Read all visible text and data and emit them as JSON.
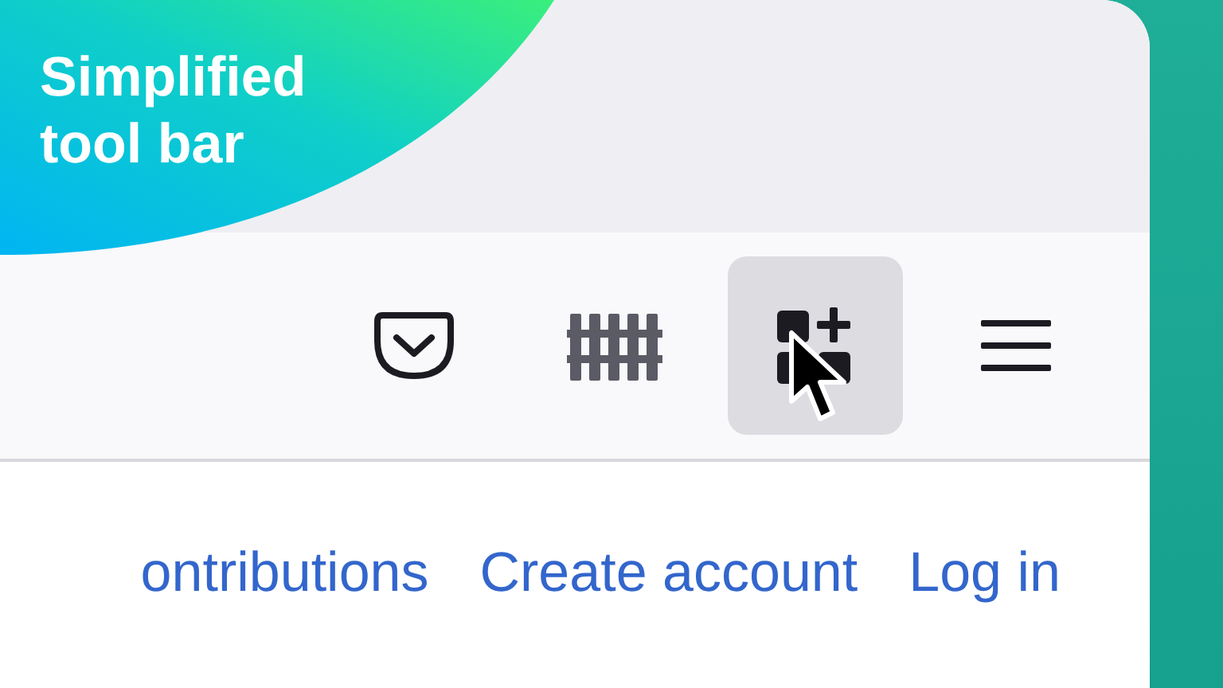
{
  "badge": {
    "text": "Simplified tool bar"
  },
  "toolbar": {
    "buttons": [
      {
        "kind": "pocket",
        "hovered": false
      },
      {
        "kind": "fence",
        "hovered": false
      },
      {
        "kind": "add-widget",
        "hovered": true
      },
      {
        "kind": "menu",
        "hovered": false
      }
    ]
  },
  "links": [
    "ontributions",
    "Create account",
    "Log in"
  ]
}
